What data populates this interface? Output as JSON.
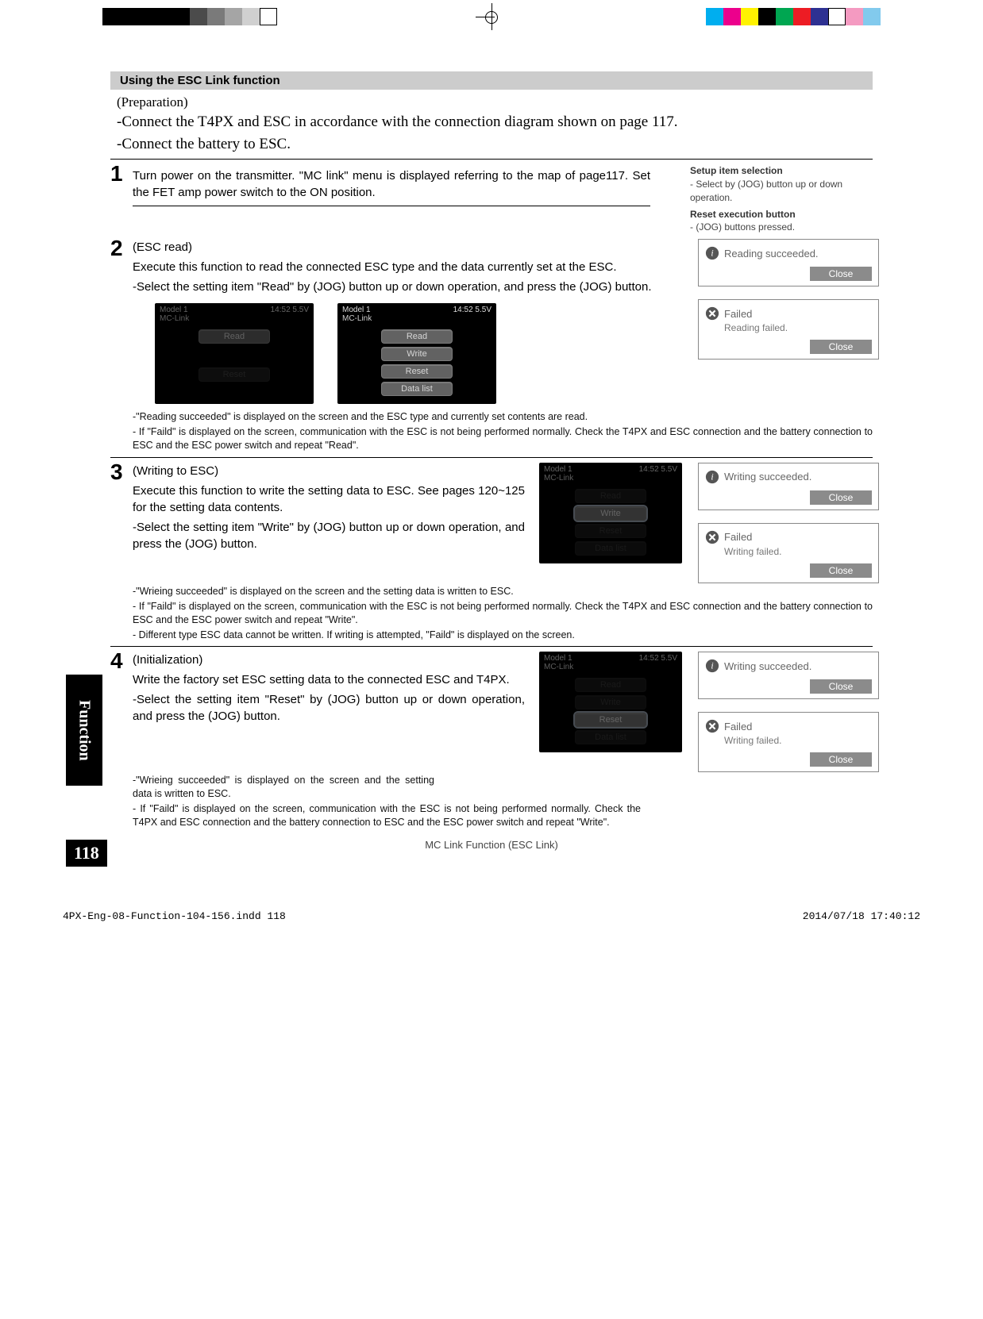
{
  "section_title": "Using the ESC Link function",
  "prep_label": "(Preparation)",
  "intro_line1": "-Connect the T4PX and ESC in accordance with the connection diagram shown on page 117.",
  "intro_line2": "-Connect the battery to ESC.",
  "tips": {
    "head1": "Setup item selection",
    "text1": "- Select by (JOG) button up or down operation.",
    "head2": "Reset execution button",
    "text2": "- (JOG) buttons pressed."
  },
  "steps": {
    "s1": {
      "num": "1",
      "p1": "Turn power on the transmitter. \"MC link\" menu is displayed referring to the map of page117.  Set the FET amp power switch to the ON position."
    },
    "s2": {
      "num": "2",
      "title": "(ESC read)",
      "p1": "Execute this function to read the connected ESC type and the data currently set at the ESC.",
      "p2": "-Select the setting item \"Read\" by (JOG) button up or down operation, and  press the (JOG) button.",
      "note1": "-\"Reading succeeded\" is displayed on the screen and the ESC type and currently set contents are read.",
      "note2": "- If \"Faild\" is displayed on the screen, communication with the ESC is not being performed normally. Check the T4PX and ESC connection and the battery connection to ESC and the ESC power switch and repeat \"Read\"."
    },
    "s3": {
      "num": "3",
      "title": "(Writing to ESC)",
      "p1": "Execute this function to write the setting data to ESC. See pages 120~125 for the setting data contents.",
      "p2": "-Select the setting item \"Write\" by (JOG) button up or down operation, and  press the (JOG) button.",
      "note1": "-\"Wrieing succeeded\" is displayed on the screen and the setting data is written to ESC.",
      "note2": "- If \"Faild\" is displayed on the screen, communication with the ESC is not being performed normally. Check the T4PX and ESC connection and the battery connection to ESC and the ESC power switch and repeat \"Write\".",
      "note3": "- Different type ESC data cannot be written. If writing is attempted, \"Faild\"  is displayed on the screen."
    },
    "s4": {
      "num": "4",
      "title": "(Initialization)",
      "p1": "Write the factory set ESC setting data to the connected ESC and T4PX.",
      "p2": "-Select the setting item \"Reset\" by (JOG) button up or down operation, and  press the (JOG) button.",
      "note1": "-\"Wrieing succeeded\" is displayed on the screen and the setting data is written to ESC.",
      "note2": "- If \"Faild\" is displayed on the screen, communication with the ESC is not being performed normally. Check the T4PX and ESC connection and the battery connection to ESC and the ESC power switch and repeat \"Write\"."
    }
  },
  "screen": {
    "model": "Model 1",
    "clock": "14:52 5.5V",
    "app": "MC-Link",
    "read": "Read",
    "write": "Write",
    "reset": "Reset",
    "datalist": "Data list"
  },
  "dialogs": {
    "read_ok": "Reading succeeded.",
    "read_fail_head": "Failed",
    "read_fail_text": "Reading failed.",
    "write_ok": "Writing succeeded.",
    "write_fail_head": "Failed",
    "write_fail_text": "Writing failed.",
    "close": "Close"
  },
  "footer": "MC Link Function  (ESC Link)",
  "page_number": "118",
  "side_tab": "Function",
  "indd_left": "4PX-Eng-08-Function-104-156.indd   118",
  "indd_right": "2014/07/18   17:40:12",
  "colorbar_left": [
    "#000",
    "#000",
    "#000",
    "#000",
    "#000",
    "#4b4b4b",
    "#7a7a7a",
    "#a5a5a5",
    "#d0d0d0",
    "#fff"
  ],
  "colorbar_right": [
    "#00aeef",
    "#ec008c",
    "#fff200",
    "#000",
    "#00a651",
    "#ed1c24",
    "#2e3192",
    "#fff",
    "#f49ac1",
    "#82caed"
  ]
}
